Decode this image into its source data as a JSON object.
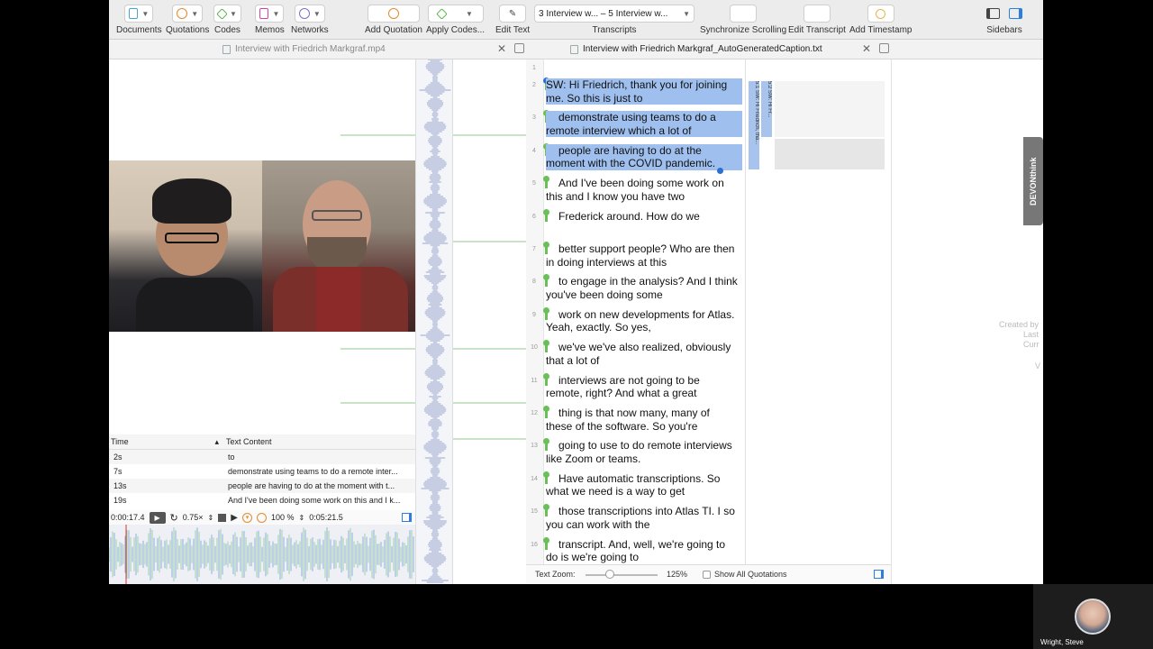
{
  "toolbar": {
    "documents": "Documents",
    "quotations": "Quotations",
    "codes": "Codes",
    "memos": "Memos",
    "networks": "Networks",
    "add_quotation": "Add Quotation",
    "apply_codes": "Apply Codes...",
    "edit_text": "Edit Text",
    "transcripts_select": "3 Interview w... – 5 Interview w...",
    "transcripts": "Transcripts",
    "sync_scrolling": "Synchronize Scrolling",
    "edit_transcript": "Edit Transcript",
    "add_timestamp": "Add Timestamp",
    "sidebars": "Sidebars"
  },
  "tabs": {
    "left": "Interview with Friedrich Markgraf.mp4",
    "right": "Interview with Friedrich Markgraf_AutoGeneratedCaption.txt"
  },
  "table": {
    "col_time": "Time",
    "col_text": "Text Content",
    "rows": [
      {
        "time": "2s",
        "text": "to"
      },
      {
        "time": "7s",
        "text": "demonstrate using teams to do a remote inter..."
      },
      {
        "time": "13s",
        "text": "people are having to do at the moment with t..."
      },
      {
        "time": "19s",
        "text": "And I've been doing some work on this and I k..."
      }
    ]
  },
  "playback": {
    "current": "0:00:17.4",
    "speed": "0.75×",
    "volume": "100 %",
    "duration": "0:05:21.5"
  },
  "doc": {
    "line_numbers": [
      "1",
      "2",
      "3",
      "4",
      "5",
      "6",
      "7",
      "8",
      "9",
      "10",
      "11",
      "12",
      "13",
      "14",
      "15",
      "16"
    ],
    "paragraphs": [
      {
        "first": "SW:   Hi Friedrich, thank you for joining",
        "rest": "me. So this is just to"
      },
      {
        "first": "demonstrate using teams to do a",
        "rest": "remote interview which a lot of"
      },
      {
        "first": "people are having to do at the",
        "rest": "moment with the COVID pandemic."
      },
      {
        "first": "And I've been doing some work on",
        "rest": "this and I know you have two"
      },
      {
        "first": "Frederick around. How do we",
        "rest": ""
      },
      {
        "first": "better support people? Who are then",
        "rest": "in doing interviews at this"
      },
      {
        "first": "to engage in the analysis? And I think",
        "rest": "you've been doing some"
      },
      {
        "first": "work on new developments for Atlas.",
        "rest": "Yeah, exactly. So yes,"
      },
      {
        "first": "we've we've also realized, obviously",
        "rest": "that a lot of"
      },
      {
        "first": "interviews are not going to be",
        "rest": "remote, right? And what a great"
      },
      {
        "first": "thing is that now many, many of",
        "rest": "these of the software. So you're"
      },
      {
        "first": "going to use to do remote interviews",
        "rest": "like Zoom or teams."
      },
      {
        "first": "Have automatic transcriptions. So",
        "rest": "what we need is a way to get"
      },
      {
        "first": "those transcriptions into Atlas TI. I so",
        "rest": "you can work with the"
      },
      {
        "first": "transcript. And, well, we're going to",
        "rest": "do is we're going to"
      }
    ],
    "quotes": [
      "5:1 SW:   Hi Friedrich, tha...",
      "5:2 SW:   Hi Fr..."
    ]
  },
  "zoom": {
    "label": "Text Zoom:",
    "value": "125%",
    "show_all": "Show All Quotations"
  },
  "side": {
    "devonthink": "DEVONthink",
    "created_by": "Created by",
    "last": "Last",
    "curr": "Curr",
    "v": "V"
  },
  "participant": {
    "name": "Wright, Steve"
  }
}
